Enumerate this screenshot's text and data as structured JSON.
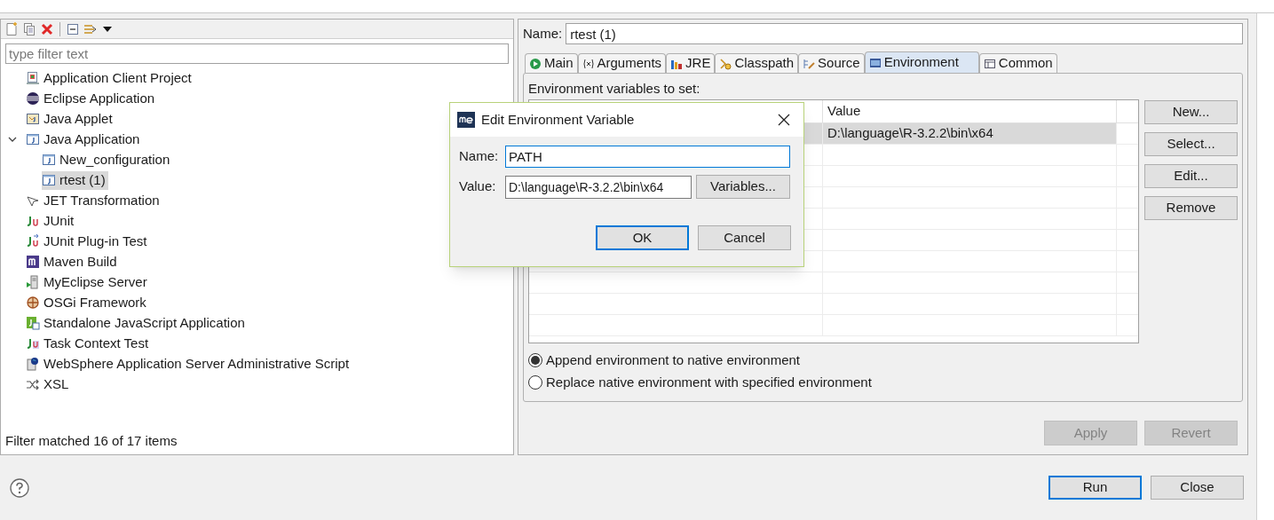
{
  "filter": {
    "placeholder": "type filter text"
  },
  "tree": [
    {
      "label": "Application Client Project",
      "selected": false
    },
    {
      "label": "Eclipse Application",
      "selected": false
    },
    {
      "label": "Java Applet",
      "selected": false
    },
    {
      "label": "Java Application",
      "selected": false,
      "expanded": true,
      "children": [
        {
          "label": "New_configuration",
          "selected": false
        },
        {
          "label": "rtest (1)",
          "selected": true
        }
      ]
    },
    {
      "label": "JET Transformation",
      "selected": false
    },
    {
      "label": "JUnit",
      "selected": false
    },
    {
      "label": "JUnit Plug-in Test",
      "selected": false
    },
    {
      "label": "Maven Build",
      "selected": false
    },
    {
      "label": "MyEclipse Server",
      "selected": false
    },
    {
      "label": "OSGi Framework",
      "selected": false
    },
    {
      "label": "Standalone JavaScript Application",
      "selected": false
    },
    {
      "label": "Task Context Test",
      "selected": false
    },
    {
      "label": "WebSphere Application Server Administrative Script",
      "selected": false
    },
    {
      "label": "XSL",
      "selected": false
    }
  ],
  "filter_status": "Filter matched 16 of 17 items",
  "name_field": {
    "label": "Name:",
    "value": "rtest (1)"
  },
  "tabs": [
    {
      "label": "Main",
      "selected": false
    },
    {
      "label": "Arguments",
      "selected": false
    },
    {
      "label": "JRE",
      "selected": false
    },
    {
      "label": "Classpath",
      "selected": false
    },
    {
      "label": "Source",
      "selected": false
    },
    {
      "label": "Environment",
      "selected": true
    },
    {
      "label": "Common",
      "selected": false
    }
  ],
  "env_heading": "Environment variables to set:",
  "table": {
    "columns": [
      "Value"
    ],
    "rows": [
      {
        "value": "D:\\language\\R-3.2.2\\bin\\x64",
        "selected": true
      }
    ]
  },
  "side_buttons": [
    "New...",
    "Select...",
    "Edit...",
    "Remove"
  ],
  "radios": [
    {
      "label": "Append environment to native environment",
      "selected": true
    },
    {
      "label": "Replace native environment with specified environment",
      "selected": false
    }
  ],
  "apply_buttons": [
    {
      "label": "Apply",
      "disabled": true
    },
    {
      "label": "Revert",
      "disabled": true
    }
  ],
  "footer_buttons": [
    {
      "label": "Run",
      "focused": true
    },
    {
      "label": "Close",
      "focused": false
    }
  ],
  "dialog": {
    "title": "Edit Environment Variable",
    "name": {
      "label": "Name:",
      "value": "PATH"
    },
    "value": {
      "label": "Value:",
      "value": "D:\\language\\R-3.2.2\\bin\\x64"
    },
    "variables_button": "Variables...",
    "buttons": [
      {
        "label": "OK",
        "focused": true
      },
      {
        "label": "Cancel",
        "focused": false
      }
    ]
  }
}
